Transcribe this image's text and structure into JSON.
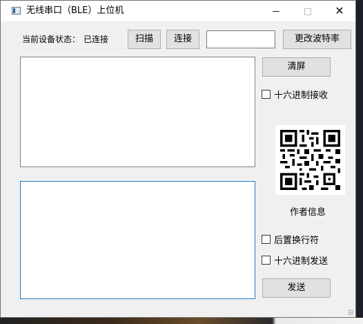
{
  "window": {
    "title": "无线串口（BLE）上位机"
  },
  "status": {
    "label": "当前设备状态：",
    "value": "已连接"
  },
  "toolbar": {
    "scan_label": "扫描",
    "connect_label": "连接",
    "baud_input_value": "",
    "change_baud_label": "更改波特率"
  },
  "receive": {
    "text": "",
    "clear_label": "清屏",
    "hex_receive_label": "十六进制接收",
    "hex_receive_checked": false
  },
  "author": {
    "info_label": "作者信息"
  },
  "send": {
    "text": "",
    "append_newline_label": "后置换行符",
    "append_newline_checked": false,
    "hex_send_label": "十六进制发送",
    "hex_send_checked": false,
    "send_label": "发送"
  },
  "icons": {
    "app": "app-window-icon",
    "minimize": "minimize-icon",
    "maximize": "maximize-icon",
    "close": "close-icon",
    "qr": "qr-code-icon"
  }
}
